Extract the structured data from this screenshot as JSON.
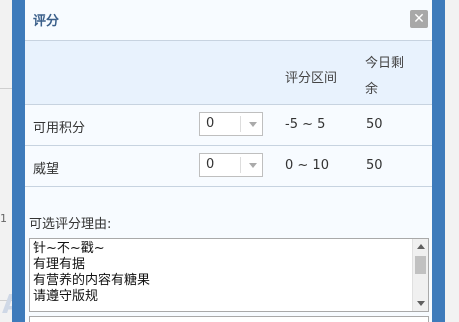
{
  "background": {
    "watermark": "A"
  },
  "dialog": {
    "title": "评分",
    "close_icon": "close-x"
  },
  "table": {
    "headers": [
      "",
      "",
      "评分区间",
      "今日剩余"
    ],
    "header_range": "评分区间",
    "header_remaining": "今日剩\n余",
    "rows": [
      {
        "label": "可用积分",
        "selected": "0",
        "range": "-5 ~ 5",
        "remaining": "50"
      },
      {
        "label": "威望",
        "selected": "0",
        "range": "0 ~ 10",
        "remaining": "50"
      }
    ]
  },
  "reason": {
    "label": "可选评分理由:",
    "options": [
      "针~不~戳~",
      "有理有据",
      "有营养的内容有糖果",
      "请遵守版规"
    ]
  },
  "colors": {
    "dialog_frame": "#3e7bbb",
    "title_text": "#3a5f8a",
    "header_bg": "#e8f2fd",
    "close_bg": "#a8a8a8"
  }
}
